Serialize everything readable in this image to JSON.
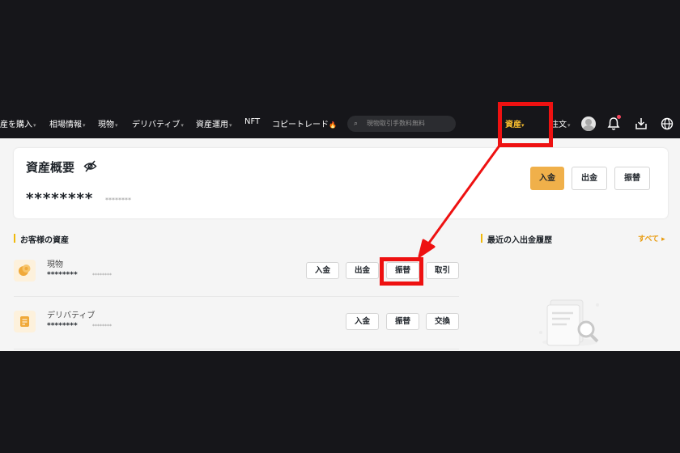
{
  "nav": {
    "items": [
      {
        "label": "産を購入",
        "caret": true
      },
      {
        "label": "相場情報",
        "caret": true
      },
      {
        "label": "現物",
        "caret": true
      },
      {
        "label": "デリバティブ",
        "caret": true
      },
      {
        "label": "資産運用",
        "caret": true
      },
      {
        "label": "NFT",
        "caret": false
      },
      {
        "label": "コピートレード",
        "caret": false
      }
    ],
    "copy_trade_flame": "🔥",
    "search_placeholder": "現物取引手数料無料",
    "assets_label": "資産",
    "assets_caret": "▾",
    "lang_label": "注文",
    "caret": "▾"
  },
  "overview": {
    "title": "資産概要",
    "masked_balance": "********",
    "masked_sub": "********",
    "deposit_label": "入金",
    "withdraw_label": "出金",
    "transfer_label": "振替"
  },
  "my_assets": {
    "title": "お客様の資産",
    "rows": [
      {
        "name": "現物",
        "icon": "coins-icon",
        "masked": "********",
        "masked_sub": "********",
        "buttons": [
          "入金",
          "出金",
          "振替",
          "取引"
        ]
      },
      {
        "name": "デリバティブ",
        "icon": "document-icon",
        "masked": "********",
        "masked_sub": "********",
        "buttons": [
          "入金",
          "振替",
          "交換"
        ]
      }
    ]
  },
  "history": {
    "title": "最近の入出金履歴",
    "all_link": "すべて",
    "all_caret": "▸"
  },
  "colors": {
    "page_bg": "#16161a",
    "nav_bg": "#16161a",
    "accent_yellow": "#f0b04a",
    "assets_active": "#f3ba2f",
    "annotation_red": "#ee1111"
  }
}
